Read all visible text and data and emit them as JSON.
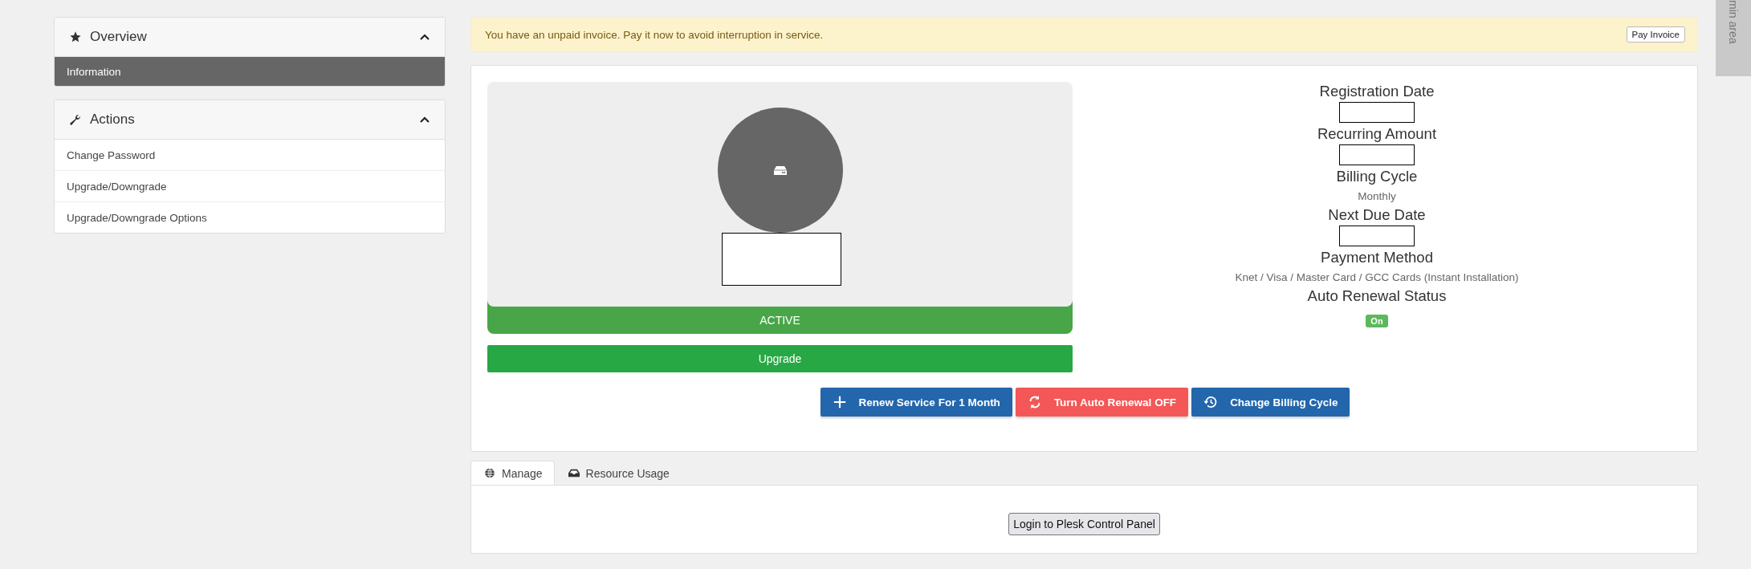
{
  "sidebar": {
    "panels": [
      {
        "title": "Overview",
        "expanded": true,
        "items": [
          {
            "label": "Information",
            "selected": true
          }
        ]
      },
      {
        "title": "Actions",
        "expanded": true,
        "items": [
          {
            "label": "Change Password",
            "selected": false
          },
          {
            "label": "Upgrade/Downgrade",
            "selected": false
          },
          {
            "label": "Upgrade/Downgrade Options",
            "selected": false
          }
        ]
      }
    ]
  },
  "alert": {
    "message": "You have an unpaid invoice. Pay it now to avoid interruption in service.",
    "button": "Pay Invoice"
  },
  "service": {
    "status": "ACTIVE",
    "upgrade_button": "Upgrade"
  },
  "details": [
    {
      "label": "Registration Date",
      "kind": "blank"
    },
    {
      "label": "Recurring Amount",
      "kind": "blank"
    },
    {
      "label": "Billing Cycle",
      "kind": "text",
      "value": "Monthly"
    },
    {
      "label": "Next Due Date",
      "kind": "blank"
    },
    {
      "label": "Payment Method",
      "kind": "text",
      "value": "Knet / Visa / Master Card / GCC Cards (Instant Installation)"
    },
    {
      "label": "Auto Renewal Status",
      "kind": "badge",
      "value": "On"
    }
  ],
  "actions": [
    {
      "label": "Renew Service For 1 Month",
      "kind": "primary"
    },
    {
      "label": "Turn Auto Renewal OFF",
      "kind": "danger"
    },
    {
      "label": "Change Billing Cycle",
      "kind": "primary"
    }
  ],
  "tabs": [
    {
      "label": "Manage",
      "selected": true
    },
    {
      "label": "Resource Usage",
      "selected": false
    }
  ],
  "tab_panel": {
    "button": "Login to Plesk Control Panel"
  },
  "side_tab": "min area"
}
